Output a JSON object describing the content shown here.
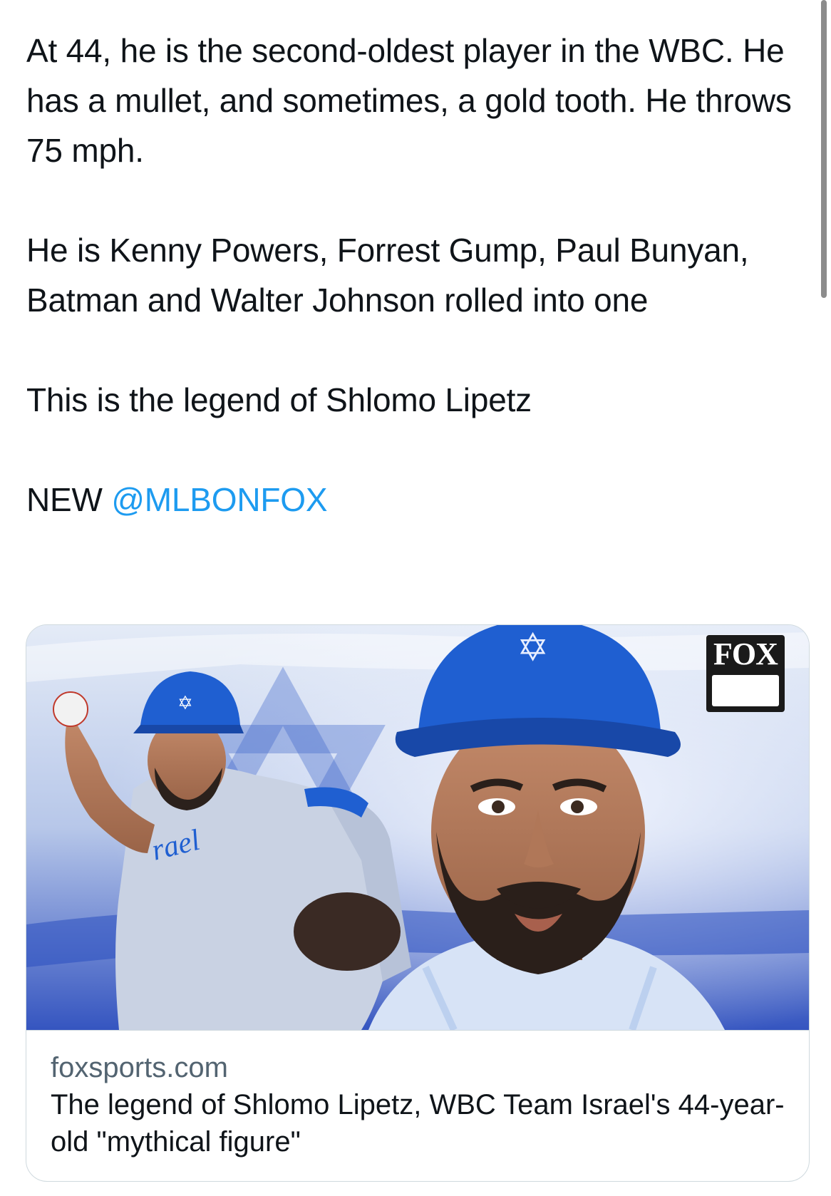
{
  "tweet": {
    "paragraphs": [
      "At 44, he is the second-oldest player in the WBC. He has a mullet, and sometimes, a gold tooth. He throws 75 mph.",
      "He is Kenny Powers, Forrest Gump, Paul Bunyan, Batman and Walter Johnson rolled into one",
      "This is the legend of Shlomo Lipetz"
    ],
    "last_line_prefix": "NEW",
    "mention": "@MLBONFOX"
  },
  "card": {
    "domain": "foxsports.com",
    "title": "The legend of Shlomo Lipetz, WBC Team Israel's 44-year-old \"mythical figure\"",
    "image": {
      "logo_text": "FOX",
      "jersey_text": "rael"
    }
  },
  "colors": {
    "mention": "#1d9bf0",
    "text": "#0f1419",
    "secondary_text": "#536471",
    "card_border": "#cfd9de",
    "israel_blue": "#1f5fd1"
  },
  "icons": {
    "logo": "fox-mlb-logo-icon",
    "cap_emblem": "star-of-david-icon"
  }
}
